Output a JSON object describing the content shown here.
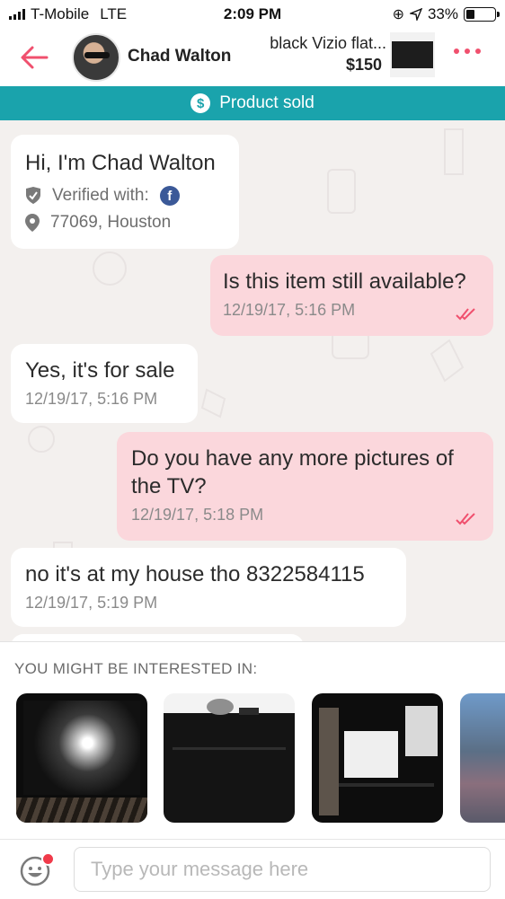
{
  "status_bar": {
    "carrier": "T-Mobile",
    "network": "LTE",
    "time": "2:09 PM",
    "battery": "33%"
  },
  "header": {
    "name": "Chad Walton",
    "product_title": "black Vizio flat...",
    "product_price": "$150"
  },
  "banner": {
    "label": "Product sold"
  },
  "profile_card": {
    "greeting": "Hi, I'm Chad Walton",
    "verified_label": "Verified with:",
    "location": "77069, Houston"
  },
  "messages": [
    {
      "direction": "out",
      "text": "Is this item still available?",
      "time": "12/19/17, 5:16 PM"
    },
    {
      "direction": "in",
      "text": "Yes, it's for sale",
      "time": "12/19/17, 5:16 PM"
    },
    {
      "direction": "out",
      "text": "Do you have any more pictures of the TV?",
      "time": "12/19/17, 5:18 PM"
    },
    {
      "direction": "in",
      "text": "no it's at my house tho 8322584115",
      "time": "12/19/17, 5:19 PM"
    }
  ],
  "suggestions": {
    "title": "YOU MIGHT BE INTERESTED IN:"
  },
  "composer": {
    "placeholder": "Type your message here"
  },
  "colors": {
    "accent": "#f0506e",
    "banner": "#1aa3ac",
    "outgoing_bubble": "#fbd7dc",
    "facebook": "#3b5998"
  }
}
